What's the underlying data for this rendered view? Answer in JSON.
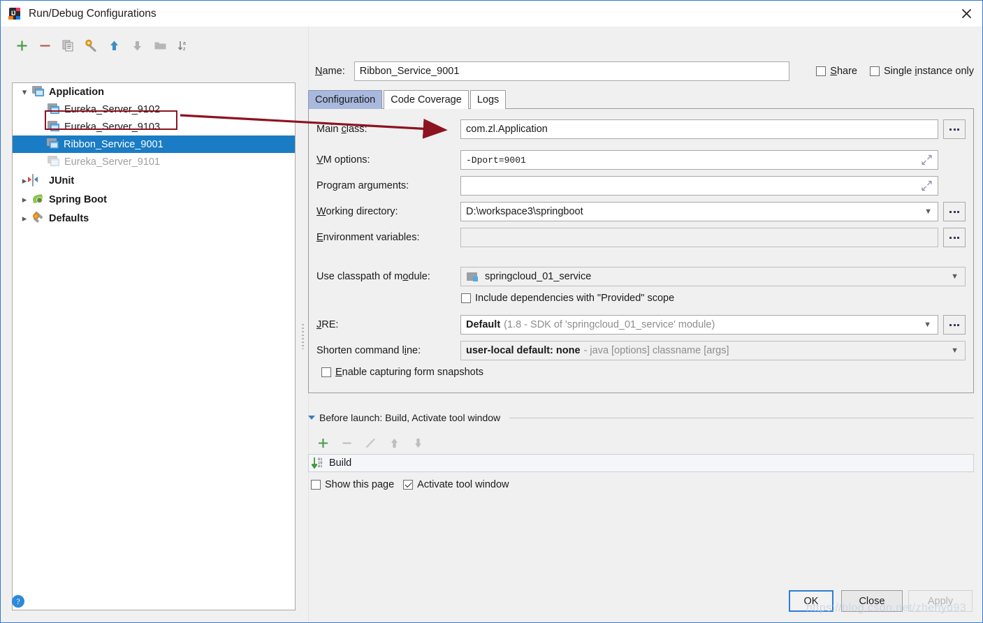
{
  "window": {
    "title": "Run/Debug Configurations",
    "app_icon": "intellij-idea-icon",
    "close_icon": "close-icon"
  },
  "left_toolbar": {
    "buttons": [
      {
        "name": "add-configuration-button",
        "icon": "plus-icon"
      },
      {
        "name": "remove-configuration-button",
        "icon": "minus-icon"
      },
      {
        "name": "copy-configuration-button",
        "icon": "copy-icon"
      },
      {
        "name": "edit-defaults-button",
        "icon": "wrench-icon"
      },
      {
        "name": "move-up-button",
        "icon": "arrow-up-icon"
      },
      {
        "name": "move-down-button",
        "icon": "arrow-down-icon"
      },
      {
        "name": "create-folder-button",
        "icon": "folder-icon"
      },
      {
        "name": "sort-configurations-button",
        "icon": "sort-az-icon"
      }
    ]
  },
  "tree": {
    "items": [
      {
        "label": "Application",
        "level": 0,
        "expander": "chevron-down-icon",
        "icon": "application-icon",
        "bold": true,
        "selected": false,
        "dim": false
      },
      {
        "label": "Eureka_Server_9102",
        "level": 1,
        "expander": "",
        "icon": "application-icon",
        "bold": false,
        "selected": false,
        "dim": false
      },
      {
        "label": "Eureka_Server_9103",
        "level": 1,
        "expander": "",
        "icon": "application-icon",
        "bold": false,
        "selected": false,
        "dim": false
      },
      {
        "label": "Ribbon_Service_9001",
        "level": 1,
        "expander": "",
        "icon": "application-icon",
        "bold": false,
        "selected": true,
        "dim": false
      },
      {
        "label": "Eureka_Server_9101",
        "level": 1,
        "expander": "",
        "icon": "application-icon",
        "bold": false,
        "selected": false,
        "dim": true
      },
      {
        "label": "JUnit",
        "level": 0,
        "expander": "chevron-right-icon",
        "icon": "junit-icon",
        "bold": true,
        "selected": false,
        "dim": false
      },
      {
        "label": "Spring Boot",
        "level": 0,
        "expander": "chevron-right-icon",
        "icon": "spring-boot-icon",
        "bold": true,
        "selected": false,
        "dim": false
      },
      {
        "label": "Defaults",
        "level": 0,
        "expander": "chevron-right-icon",
        "icon": "wrench-icon",
        "bold": true,
        "selected": false,
        "dim": false
      }
    ]
  },
  "name_row": {
    "label": "Name:",
    "value": "Ribbon_Service_9001",
    "share_label": "Share",
    "share_checked": false,
    "single_instance_label": "Single instance only",
    "single_instance_checked": false
  },
  "tabs": [
    {
      "label": "Configuration",
      "active": true
    },
    {
      "label": "Code Coverage",
      "active": false
    },
    {
      "label": "Logs",
      "active": false
    }
  ],
  "configuration": {
    "main_class": {
      "label": "Main class:",
      "value": "com.zl.Application",
      "browse": "browse-icon"
    },
    "vm_options": {
      "label": "VM options:",
      "value": "-Dport=9001",
      "expand": "expand-icon"
    },
    "program_arguments": {
      "label": "Program arguments:",
      "value": "",
      "expand": "expand-icon"
    },
    "working_directory": {
      "label": "Working directory:",
      "value": "D:\\workspace3\\springboot",
      "browse": "browse-icon"
    },
    "environment_variables": {
      "label": "Environment variables:",
      "value": "",
      "browse": "browse-icon"
    },
    "use_classpath": {
      "label": "Use classpath of module:",
      "value": "springcloud_01_service",
      "icon": "module-icon"
    },
    "include_provided": {
      "label": "Include dependencies with \"Provided\" scope",
      "checked": false
    },
    "jre": {
      "label": "JRE:",
      "value": "Default",
      "hint": "(1.8 - SDK of 'springcloud_01_service' module)",
      "browse": "browse-icon"
    },
    "shorten_command_line": {
      "label": "Shorten command line:",
      "value": "user-local default: none",
      "hint": "- java [options] classname [args]"
    },
    "enable_snapshots": {
      "label": "Enable capturing form snapshots",
      "checked": false
    }
  },
  "before_launch": {
    "header": "Before launch: Build, Activate tool window",
    "toolbar": [
      {
        "name": "add-task-button",
        "icon": "plus-icon"
      },
      {
        "name": "remove-task-button",
        "icon": "minus-icon"
      },
      {
        "name": "edit-task-button",
        "icon": "pencil-icon"
      },
      {
        "name": "move-task-up-button",
        "icon": "arrow-up-icon"
      },
      {
        "name": "move-task-down-button",
        "icon": "arrow-down-icon"
      }
    ],
    "tasks": [
      {
        "label": "Build",
        "icon": "build-icon"
      }
    ],
    "show_this_page": {
      "label": "Show this page",
      "checked": false
    },
    "activate_tool_window": {
      "label": "Activate tool window",
      "checked": true
    }
  },
  "bottom": {
    "help_icon": "help-icon",
    "ok_label": "OK",
    "close_label": "Close",
    "apply_label": "Apply"
  },
  "watermark": {
    "text": "https://blog.csdn.net/zhenyu93"
  },
  "colors": {
    "selection_blue": "#1a7cc4",
    "annotation_red": "#8d1320",
    "accent_border": "#2e7cd6",
    "tab_active": "#a9b8dd"
  }
}
